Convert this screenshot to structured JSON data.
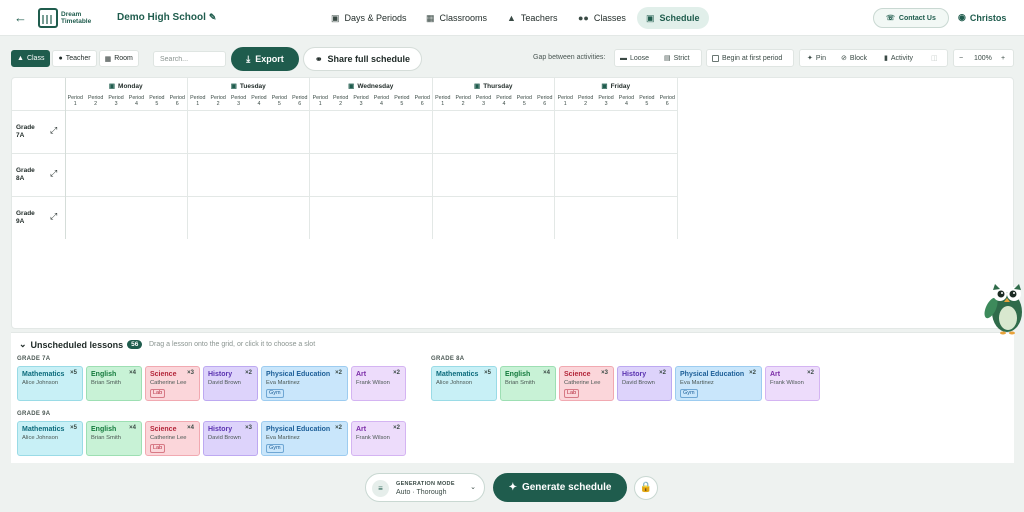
{
  "header": {
    "logo_line1": "Dream",
    "logo_line2": "Timetable",
    "school_name": "Demo High School",
    "nav": [
      {
        "label": "Days & Periods",
        "icon": "calendar-icon"
      },
      {
        "label": "Classrooms",
        "icon": "building-icon"
      },
      {
        "label": "Teachers",
        "icon": "graduation-cap-icon"
      },
      {
        "label": "Classes",
        "icon": "users-icon"
      },
      {
        "label": "Schedule",
        "icon": "calendar-icon",
        "active": true
      }
    ],
    "contact_label": "Contact Us",
    "user_name": "Christos"
  },
  "toolbar": {
    "view_modes": [
      "Class",
      "Teacher",
      "Room"
    ],
    "active_view": "Class",
    "search_placeholder": "Search...",
    "export_label": "Export",
    "share_label": "Share full schedule",
    "gap_label": "Gap between activities:",
    "loose_label": "Loose",
    "strict_label": "Strict",
    "first_period_label": "Begin at first period",
    "pin_label": "Pin",
    "block_label": "Block",
    "activity_label": "Activity",
    "zoom": "100%"
  },
  "schedule": {
    "days": [
      "Monday",
      "Tuesday",
      "Wednesday",
      "Thursday",
      "Friday"
    ],
    "periods_per_day": [
      [
        "Period",
        "1"
      ],
      [
        "Period",
        "2"
      ],
      [
        "Period",
        "3"
      ],
      [
        "Period",
        "4"
      ],
      [
        "Period",
        "5"
      ],
      [
        "Period",
        "6"
      ]
    ],
    "classes": [
      {
        "line1": "Grade",
        "line2": "7A"
      },
      {
        "line1": "Grade",
        "line2": "8A"
      },
      {
        "line1": "Grade",
        "line2": "9A"
      }
    ]
  },
  "unscheduled": {
    "title": "Unscheduled lessons",
    "count": "56",
    "hint": "Drag a lesson onto the grid, or click it to choose a slot",
    "groups": [
      {
        "grade": "GRADE 7A",
        "lessons": [
          {
            "subject": "Mathematics",
            "teacher": "Alice Johnson",
            "mult": "×5",
            "color": "math"
          },
          {
            "subject": "English",
            "teacher": "Brian Smith",
            "mult": "×4",
            "color": "eng"
          },
          {
            "subject": "Science",
            "teacher": "Catherine Lee",
            "mult": "×3",
            "room": "Lab",
            "color": "sci"
          },
          {
            "subject": "History",
            "teacher": "David Brown",
            "mult": "×2",
            "color": "hist"
          },
          {
            "subject": "Physical Education",
            "teacher": "Eva Martinez",
            "mult": "×2",
            "room": "Gym",
            "color": "pe"
          },
          {
            "subject": "Art",
            "teacher": "Frank Wilson",
            "mult": "×2",
            "color": "art"
          }
        ]
      },
      {
        "grade": "GRADE 8A",
        "lessons": [
          {
            "subject": "Mathematics",
            "teacher": "Alice Johnson",
            "mult": "×5",
            "color": "math"
          },
          {
            "subject": "English",
            "teacher": "Brian Smith",
            "mult": "×4",
            "color": "eng"
          },
          {
            "subject": "Science",
            "teacher": "Catherine Lee",
            "mult": "×3",
            "room": "Lab",
            "color": "sci"
          },
          {
            "subject": "History",
            "teacher": "David Brown",
            "mult": "×2",
            "color": "hist"
          },
          {
            "subject": "Physical Education",
            "teacher": "Eva Martinez",
            "mult": "×2",
            "room": "Gym",
            "color": "pe"
          },
          {
            "subject": "Art",
            "teacher": "Frank Wilson",
            "mult": "×2",
            "color": "art"
          }
        ]
      },
      {
        "grade": "GRADE 9A",
        "lessons": [
          {
            "subject": "Mathematics",
            "teacher": "Alice Johnson",
            "mult": "×5",
            "color": "math"
          },
          {
            "subject": "English",
            "teacher": "Brian Smith",
            "mult": "×4",
            "color": "eng"
          },
          {
            "subject": "Science",
            "teacher": "Catherine Lee",
            "mult": "×4",
            "room": "Lab",
            "color": "sci"
          },
          {
            "subject": "History",
            "teacher": "David Brown",
            "mult": "×3",
            "color": "hist"
          },
          {
            "subject": "Physical Education",
            "teacher": "Eva Martinez",
            "mult": "×2",
            "room": "Gym",
            "color": "pe"
          },
          {
            "subject": "Art",
            "teacher": "Frank Wilson",
            "mult": "×2",
            "color": "art"
          }
        ]
      }
    ]
  },
  "footer": {
    "mode_title": "GENERATION MODE",
    "mode_value": "Auto · Thorough",
    "generate_label": "Generate schedule"
  },
  "colors": {
    "brand": "#1f5c4d",
    "math": "#c8f0f6",
    "english": "#c8f2d6",
    "science": "#fbd6da",
    "history": "#ddd3fb",
    "pe": "#c9e6fb",
    "art": "#eddcfb"
  }
}
